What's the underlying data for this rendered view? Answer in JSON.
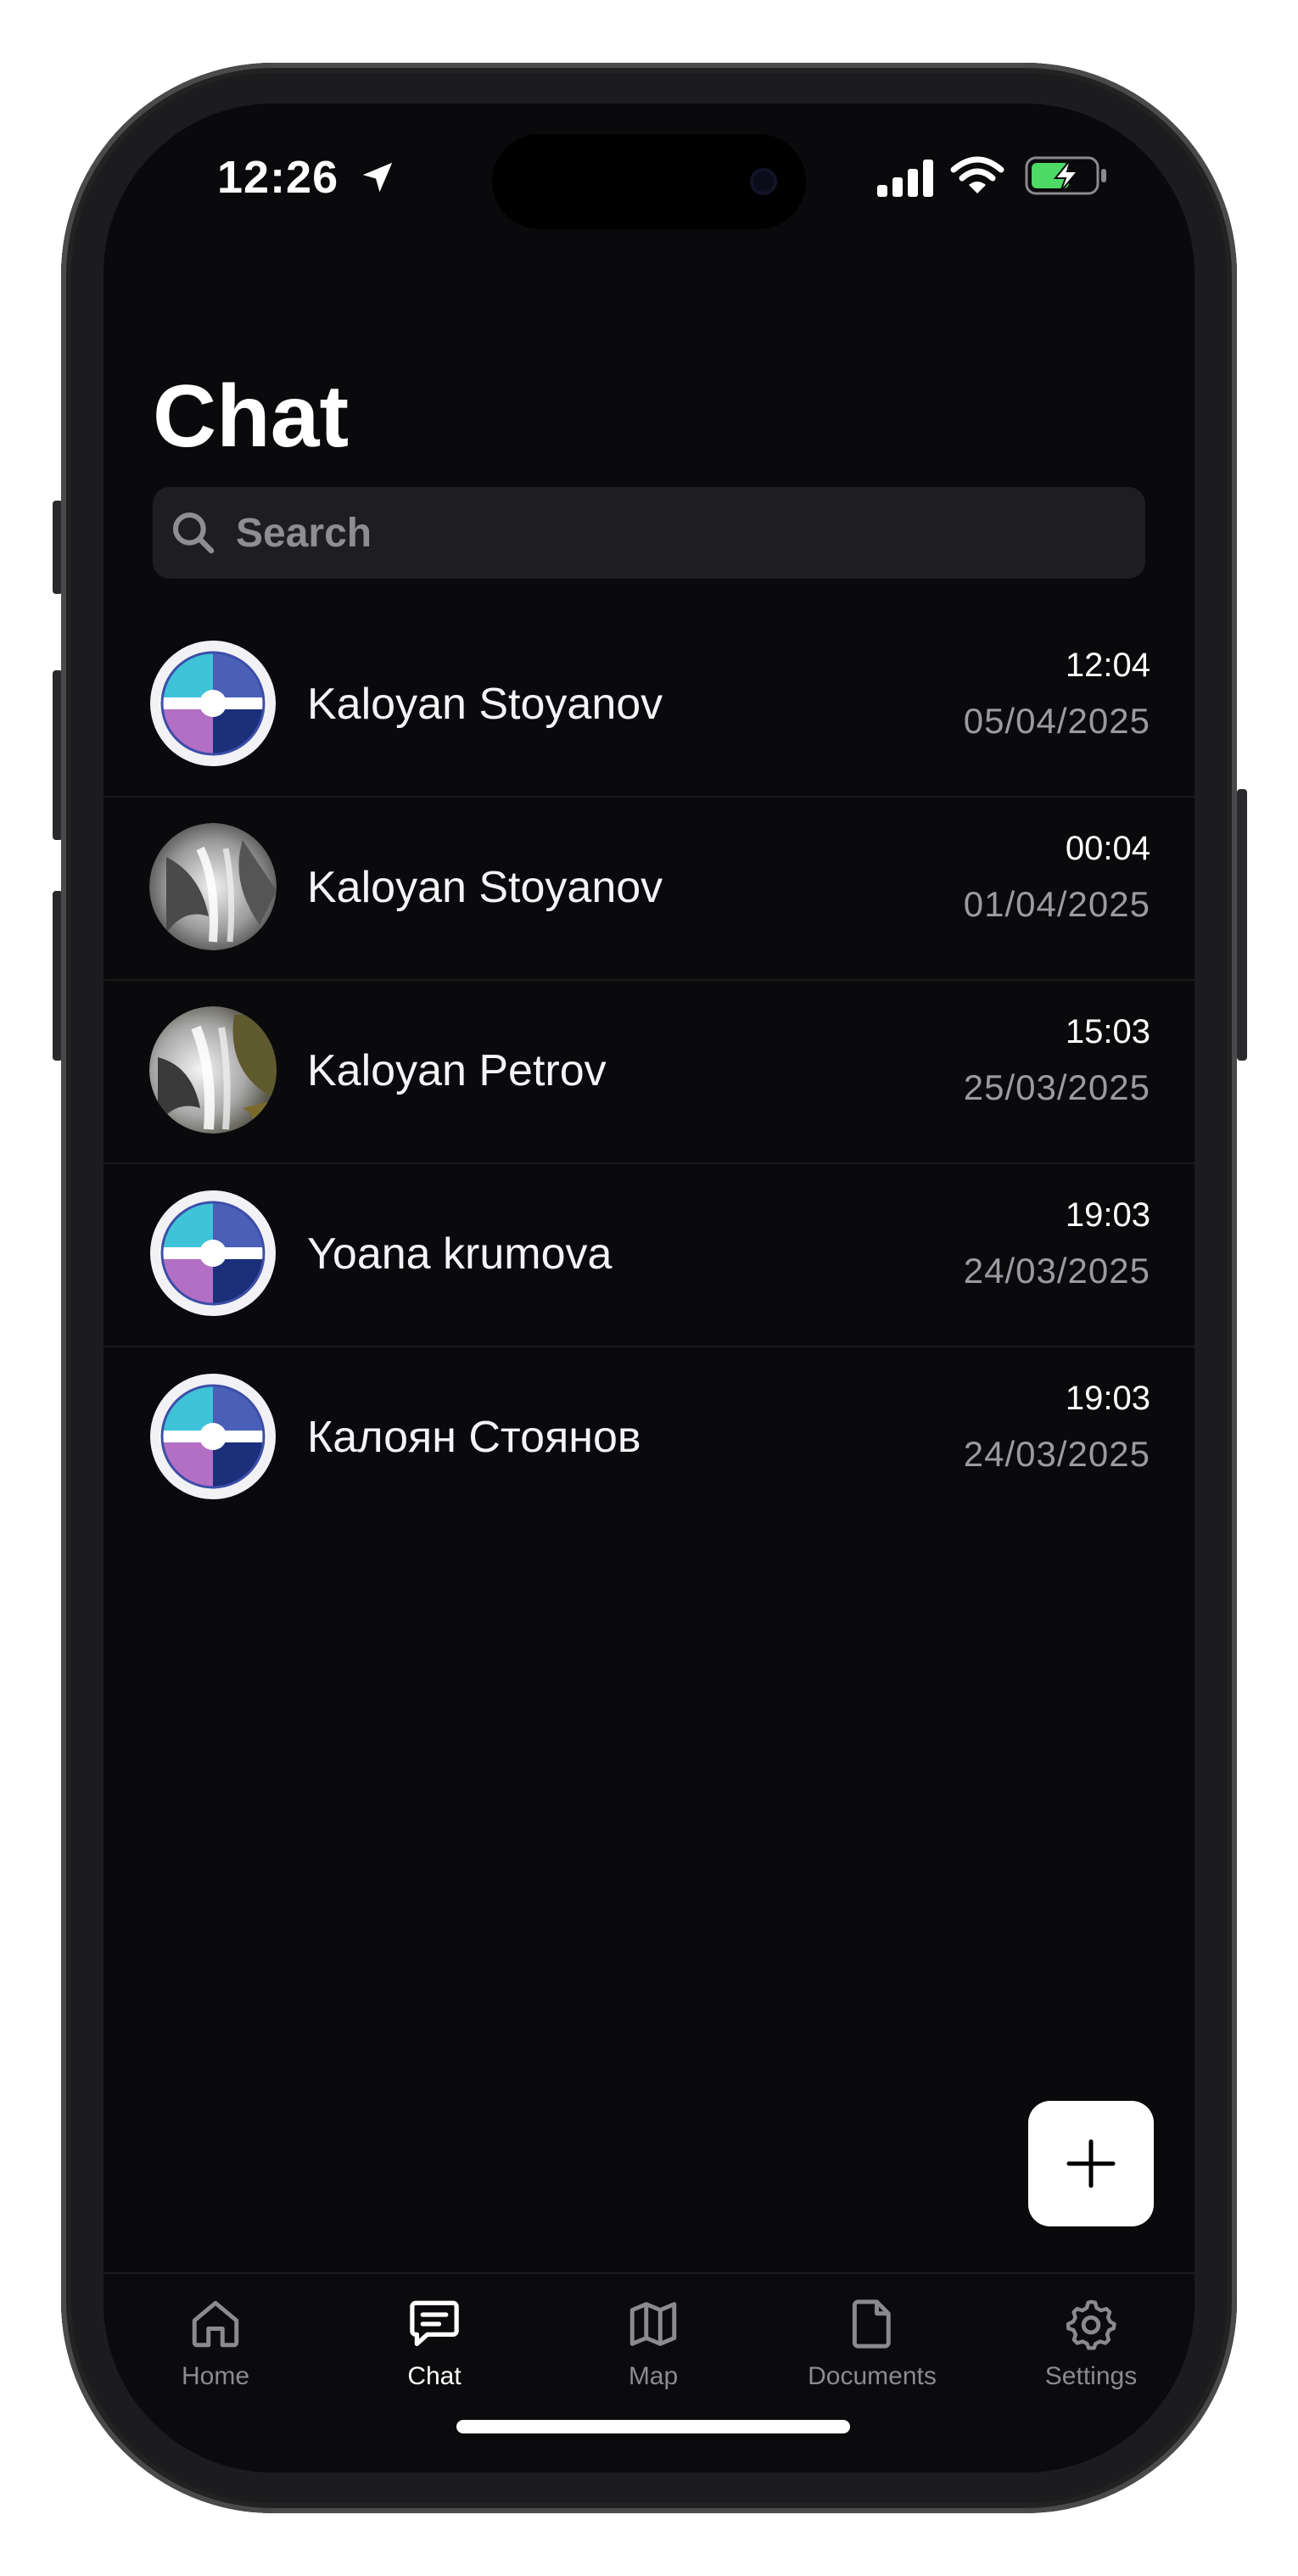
{
  "status_bar": {
    "time": "12:26"
  },
  "header": {
    "title": "Chat"
  },
  "search": {
    "placeholder": "Search"
  },
  "chats": [
    {
      "name": "Kaloyan Stoyanov",
      "time": "12:04",
      "date": "05/04/2025",
      "avatar": "logo-avatar"
    },
    {
      "name": "Kaloyan Stoyanov",
      "time": "00:04",
      "date": "01/04/2025",
      "avatar": "waterfall-photo-avatar"
    },
    {
      "name": "Kaloyan Petrov",
      "time": "15:03",
      "date": "25/03/2025",
      "avatar": "waterfall-photo-avatar"
    },
    {
      "name": "Yoana krumova",
      "time": "19:03",
      "date": "24/03/2025",
      "avatar": "logo-avatar"
    },
    {
      "name": "Калоян Стоянов",
      "time": "19:03",
      "date": "24/03/2025",
      "avatar": "logo-avatar"
    }
  ],
  "fab": {
    "icon": "plus-icon"
  },
  "tabs": [
    {
      "label": "Home",
      "icon": "home-icon",
      "active": false
    },
    {
      "label": "Chat",
      "icon": "chat-icon",
      "active": true
    },
    {
      "label": "Map",
      "icon": "map-icon",
      "active": false
    },
    {
      "label": "Documents",
      "icon": "document-icon",
      "active": false
    },
    {
      "label": "Settings",
      "icon": "gear-icon",
      "active": false
    }
  ],
  "colors": {
    "background": "#0a0a0c",
    "search_bg": "#1e1e21",
    "text": "#ffffff",
    "muted": "#8a8a8f",
    "battery_green": "#4cd964"
  }
}
